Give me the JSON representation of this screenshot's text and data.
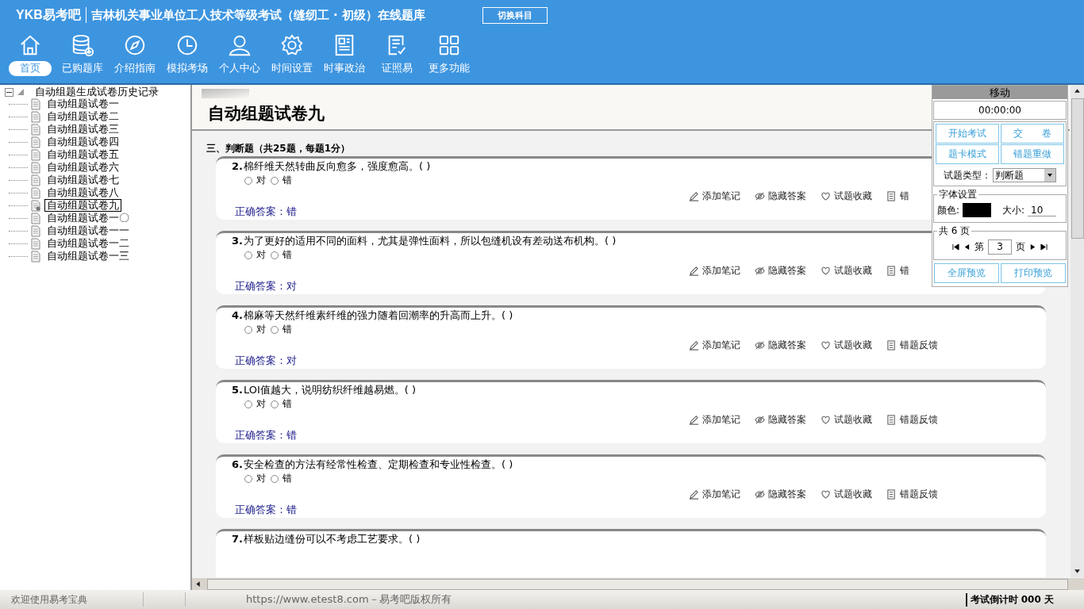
{
  "header": {
    "brand": "YKB易考吧",
    "title": "吉林机关事业单位工人技术等级考试（缝纫工 · 初级）在线题库",
    "switch_button": "切换科目"
  },
  "nav": [
    {
      "label": "首页",
      "selected": true
    },
    {
      "label": "已购题库",
      "selected": false
    },
    {
      "label": "介绍指南",
      "selected": false
    },
    {
      "label": "模拟考场",
      "selected": false
    },
    {
      "label": "个人中心",
      "selected": false
    },
    {
      "label": "时间设置",
      "selected": false
    },
    {
      "label": "时事政治",
      "selected": false
    },
    {
      "label": "证照易",
      "selected": false
    },
    {
      "label": "更多功能",
      "selected": false
    }
  ],
  "tree": {
    "label": "自动组题生成试卷历史记录",
    "expanded": true,
    "children": [
      {
        "label": "自动组题试卷一",
        "selected": false
      },
      {
        "label": "自动组题试卷二",
        "selected": false
      },
      {
        "label": "自动组题试卷三",
        "selected": false
      },
      {
        "label": "自动组题试卷四",
        "selected": false
      },
      {
        "label": "自动组题试卷五",
        "selected": false
      },
      {
        "label": "自动组题试卷六",
        "selected": false
      },
      {
        "label": "自动组题试卷七",
        "selected": false
      },
      {
        "label": "自动组题试卷八",
        "selected": false
      },
      {
        "label": "自动组题试卷九",
        "selected": true
      },
      {
        "label": "自动组题试卷一〇",
        "selected": false
      },
      {
        "label": "自动组题试卷一一",
        "selected": false
      },
      {
        "label": "自动组题试卷一二",
        "selected": false
      },
      {
        "label": "自动组题试卷一三",
        "selected": false
      }
    ]
  },
  "paper_title": "自动组题试卷九",
  "section_title": "三、判断题（共25题，每题1分）",
  "questions": [
    {
      "number": "2.",
      "text": "棉纤维天然转曲反向愈多，强度愈高。( )",
      "options": [
        {
          "label": "对",
          "selected": false
        },
        {
          "label": "错",
          "selected": false
        }
      ],
      "answer_label": "正确答案：",
      "answer": "错",
      "actions": [
        "添加笔记",
        "隐藏答案",
        "试题收藏",
        "错"
      ]
    },
    {
      "number": "3.",
      "text": "为了更好的适用不同的面料，尤其是弹性面料，所以包缝机设有差动送布机构。( )",
      "options": [
        {
          "label": "对",
          "selected": false
        },
        {
          "label": "错",
          "selected": false
        }
      ],
      "answer_label": "正确答案：",
      "answer": "对",
      "actions": [
        "添加笔记",
        "隐藏答案",
        "试题收藏",
        "错"
      ]
    },
    {
      "number": "4.",
      "text": "棉麻等天然纤维素纤维的强力随着回潮率的升高而上升。( )",
      "options": [
        {
          "label": "对",
          "selected": false
        },
        {
          "label": "错",
          "selected": false
        }
      ],
      "answer_label": "正确答案：",
      "answer": "对",
      "actions": [
        "添加笔记",
        "隐藏答案",
        "试题收藏",
        "错题反馈"
      ]
    },
    {
      "number": "5.",
      "text": "LOI值越大，说明纺织纤维越易燃。( )",
      "options": [
        {
          "label": "对",
          "selected": false
        },
        {
          "label": "错",
          "selected": false
        }
      ],
      "answer_label": "正确答案：",
      "answer": "错",
      "actions": [
        "添加笔记",
        "隐藏答案",
        "试题收藏",
        "错题反馈"
      ]
    },
    {
      "number": "6.",
      "text": "安全检查的方法有经常性检查、定期检查和专业性检查。( )",
      "options": [
        {
          "label": "对",
          "selected": false
        },
        {
          "label": "错",
          "selected": false
        }
      ],
      "answer_label": "正确答案：",
      "answer": "错",
      "actions": [
        "添加笔记",
        "隐藏答案",
        "试题收藏",
        "错题反馈"
      ]
    },
    {
      "number": "7.",
      "text": "样板贴边缝份可以不考虑工艺要求。( )"
    }
  ],
  "panel": {
    "header": "移动",
    "timer": "00:00:00",
    "buttons": [
      "开始考试",
      "交　　卷",
      "题卡模式",
      "错题重做"
    ],
    "type_label": "试题类型：",
    "type_value": "判断题",
    "font_legend": "字体设置",
    "color_label": "颜色:",
    "size_label": "大小:",
    "size_value": "10",
    "pages_legend": "共 6 页",
    "page_prefix": "第",
    "page_value": "3",
    "page_suffix": "页",
    "bottom_buttons": [
      "全屏预览",
      "打印预览"
    ]
  },
  "status_bar": {
    "welcome": "欢迎使用易考宝典",
    "copyright": "https://www.etest8.com－易考吧版权所有",
    "countdown": "考试倒计时 000 天"
  }
}
